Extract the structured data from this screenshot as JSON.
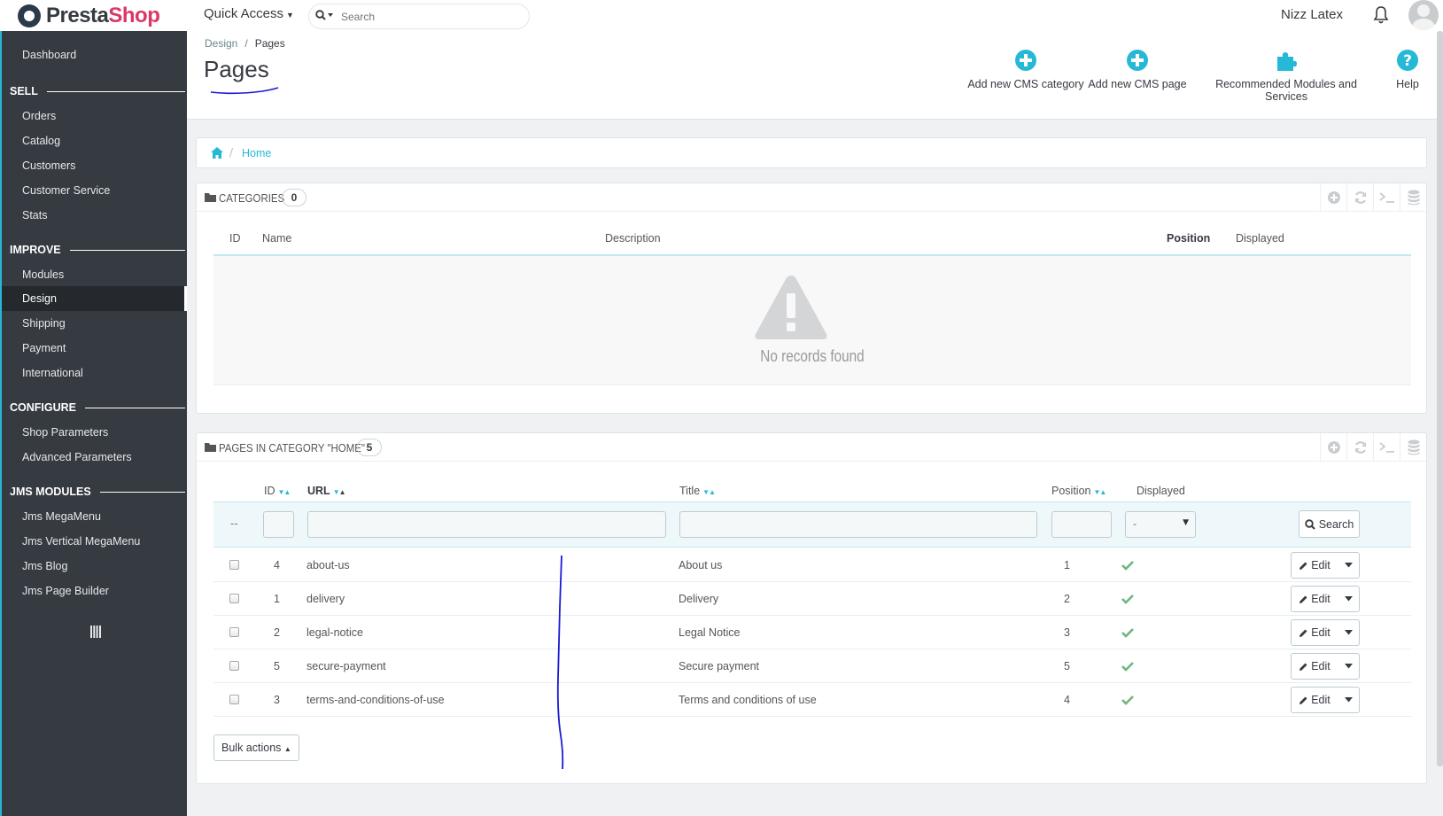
{
  "header": {
    "logo_text_a": "Presta",
    "logo_text_b": "Shop",
    "quick_access": "Quick Access",
    "search_placeholder": "Search",
    "user_name": "Nizz Latex"
  },
  "sidebar": {
    "dashboard": "Dashboard",
    "sections": [
      {
        "title": "SELL",
        "items": [
          "Orders",
          "Catalog",
          "Customers",
          "Customer Service",
          "Stats"
        ]
      },
      {
        "title": "IMPROVE",
        "items": [
          "Modules",
          "Design",
          "Shipping",
          "Payment",
          "International"
        ]
      },
      {
        "title": "CONFIGURE",
        "items": [
          "Shop Parameters",
          "Advanced Parameters"
        ]
      },
      {
        "title": "JMS MODULES",
        "items": [
          "Jms MegaMenu",
          "Jms Vertical MegaMenu",
          "Jms Blog",
          "Jms Page Builder"
        ]
      }
    ],
    "active_item": "Design"
  },
  "page": {
    "breadcrumb": [
      "Design",
      "Pages"
    ],
    "title": "Pages",
    "toolbar": [
      "Add new CMS category",
      "Add new CMS page",
      "Recommended Modules and Services",
      "Help"
    ]
  },
  "tree": {
    "home": "Home"
  },
  "categories": {
    "title": "Categories",
    "count": "0",
    "columns": [
      "ID",
      "Name",
      "Description",
      "Position",
      "Displayed"
    ],
    "empty_text": "No records found"
  },
  "pages": {
    "title": "Pages in category \"Home\"",
    "count": "5",
    "columns": [
      "ID",
      "URL",
      "Title",
      "Position",
      "Displayed"
    ],
    "filter_dash": "--",
    "filter_select": "-",
    "search_label": "Search",
    "edit_label": "Edit",
    "bulk_label": "Bulk actions",
    "rows": [
      {
        "id": "4",
        "url": "about-us",
        "title": "About us",
        "position": "1"
      },
      {
        "id": "1",
        "url": "delivery",
        "title": "Delivery",
        "position": "2"
      },
      {
        "id": "2",
        "url": "legal-notice",
        "title": "Legal Notice",
        "position": "3"
      },
      {
        "id": "5",
        "url": "secure-payment",
        "title": "Secure payment",
        "position": "5"
      },
      {
        "id": "3",
        "url": "terms-and-conditions-of-use",
        "title": "Terms and conditions of use",
        "position": "4"
      }
    ]
  },
  "colors": {
    "accent": "#25b9d7",
    "sidebar": "#363a41",
    "brand": "#db3767",
    "success": "#70b580"
  }
}
